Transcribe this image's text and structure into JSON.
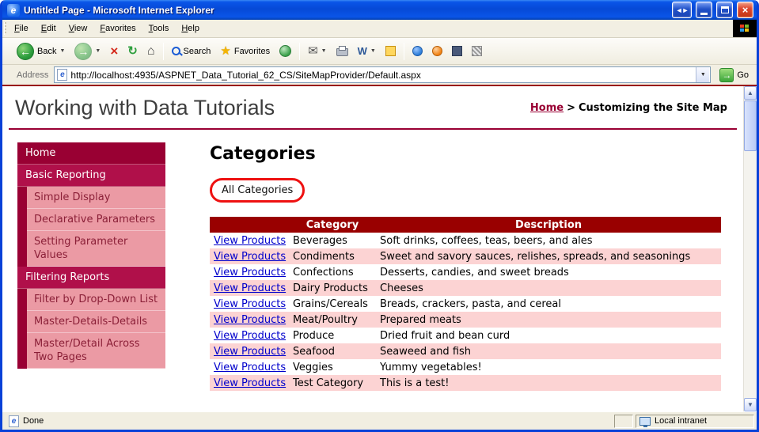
{
  "window": {
    "title": "Untitled Page - Microsoft Internet Explorer"
  },
  "menu": {
    "items": [
      "File",
      "Edit",
      "View",
      "Favorites",
      "Tools",
      "Help"
    ]
  },
  "toolbar": {
    "back_label": "Back",
    "search_label": "Search",
    "favorites_label": "Favorites"
  },
  "address": {
    "label": "Address",
    "url": "http://localhost:4935/ASPNET_Data_Tutorial_62_CS/SiteMapProvider/Default.aspx",
    "go_label": "Go"
  },
  "page": {
    "title": "Working with Data Tutorials",
    "breadcrumb": {
      "home": "Home",
      "separator": ">",
      "current": "Customizing the Site Map"
    },
    "sidebar": {
      "items": [
        "Home",
        "Basic Reporting",
        "Simple Display",
        "Declarative Parameters",
        "Setting Parameter Values",
        "Filtering Reports",
        "Filter by Drop-Down List",
        "Master-Details-Details",
        "Master/Detail Across Two Pages"
      ]
    },
    "main": {
      "heading": "Categories",
      "filter_badge": "All Categories",
      "table": {
        "headers": [
          "",
          "Category",
          "Description"
        ],
        "link_label": "View Products",
        "rows": [
          {
            "category": "Beverages",
            "description": "Soft drinks, coffees, teas, beers, and ales"
          },
          {
            "category": "Condiments",
            "description": "Sweet and savory sauces, relishes, spreads, and seasonings"
          },
          {
            "category": "Confections",
            "description": "Desserts, candies, and sweet breads"
          },
          {
            "category": "Dairy Products",
            "description": "Cheeses"
          },
          {
            "category": "Grains/Cereals",
            "description": "Breads, crackers, pasta, and cereal"
          },
          {
            "category": "Meat/Poultry",
            "description": "Prepared meats"
          },
          {
            "category": "Produce",
            "description": "Dried fruit and bean curd"
          },
          {
            "category": "Seafood",
            "description": "Seaweed and fish"
          },
          {
            "category": "Veggies",
            "description": "Yummy vegetables!"
          },
          {
            "category": "Test Category",
            "description": "This is a test!"
          }
        ]
      }
    }
  },
  "status": {
    "left": "Done",
    "right": "Local intranet"
  },
  "icons": {
    "ie_logo": "e",
    "titlebar_arrows": "◄►",
    "close": "×",
    "back_arrow": "←",
    "forward_arrow": "→",
    "stop": "×",
    "refresh": "↻",
    "home": "⌂",
    "favorites_star": "★",
    "mail": "✉",
    "word_edit": "W",
    "caret_down": "▼",
    "scroll_up": "▲",
    "scroll_down": "▼",
    "go_arrow": "→"
  },
  "colors": {
    "titlebar_blue": "#0a55e3",
    "accent_maroon": "#990033",
    "section_crimson": "#b0104a",
    "sidebar_pink": "#eb9aa4",
    "table_header_red": "#990000",
    "alt_row_pink": "#fcd3d3",
    "link_blue": "#0000cc",
    "annotation_red": "#ee1111"
  }
}
